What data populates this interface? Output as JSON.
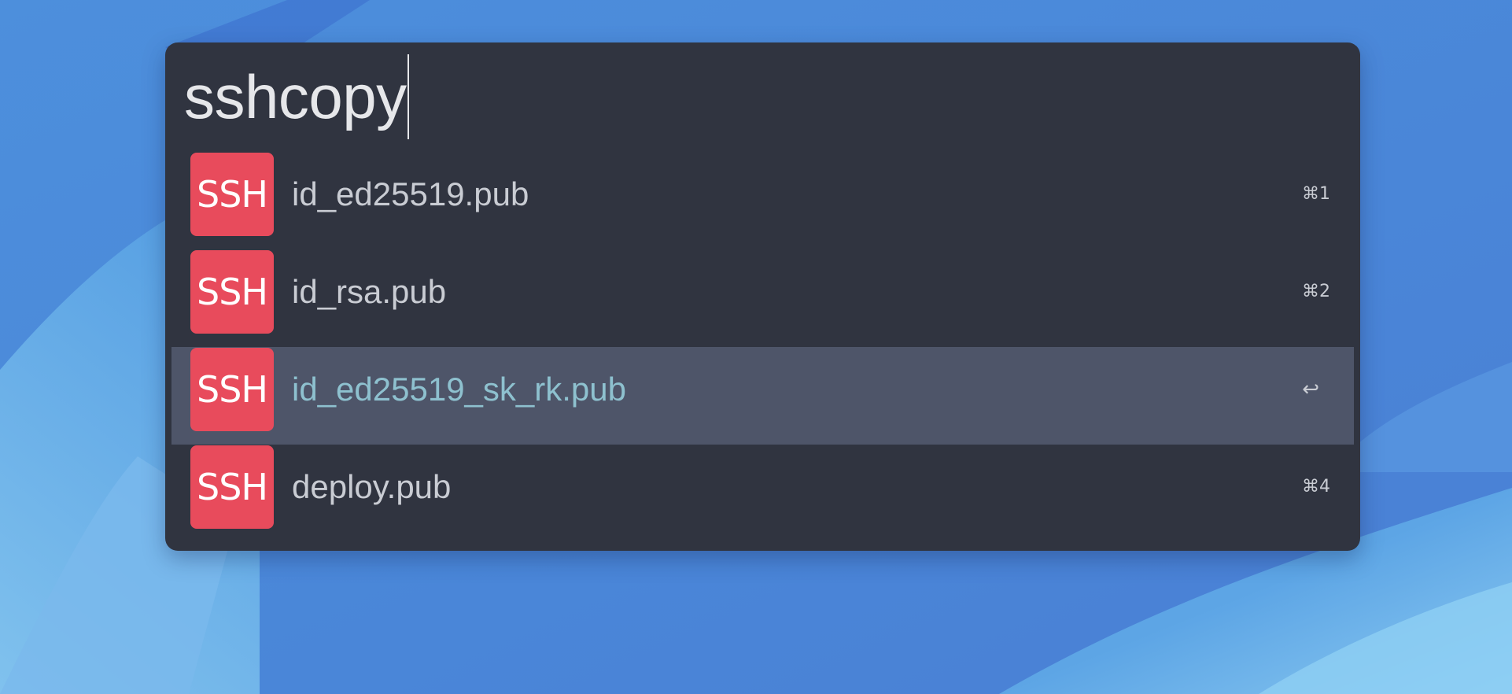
{
  "wallpaper": {
    "colors": {
      "base": "#4f8fdc",
      "light": "#7fc0ee",
      "dark": "#3a6fd0"
    }
  },
  "launcher": {
    "query": "sshcopy",
    "results": [
      {
        "icon_text": "SSH",
        "label": "id_ed25519.pub",
        "shortcut": "⌘1",
        "selected": false
      },
      {
        "icon_text": "SSH",
        "label": "id_rsa.pub",
        "shortcut": "⌘2",
        "selected": false
      },
      {
        "icon_text": "SSH",
        "label": "id_ed25519_sk_rk.pub",
        "shortcut": "↩",
        "selected": true
      },
      {
        "icon_text": "SSH",
        "label": "deploy.pub",
        "shortcut": "⌘4",
        "selected": false
      }
    ],
    "colors": {
      "panel": "#303440",
      "selected_row": "#4e5569",
      "icon": "#e84b5c",
      "selected_text": "#8ec1cf"
    }
  }
}
